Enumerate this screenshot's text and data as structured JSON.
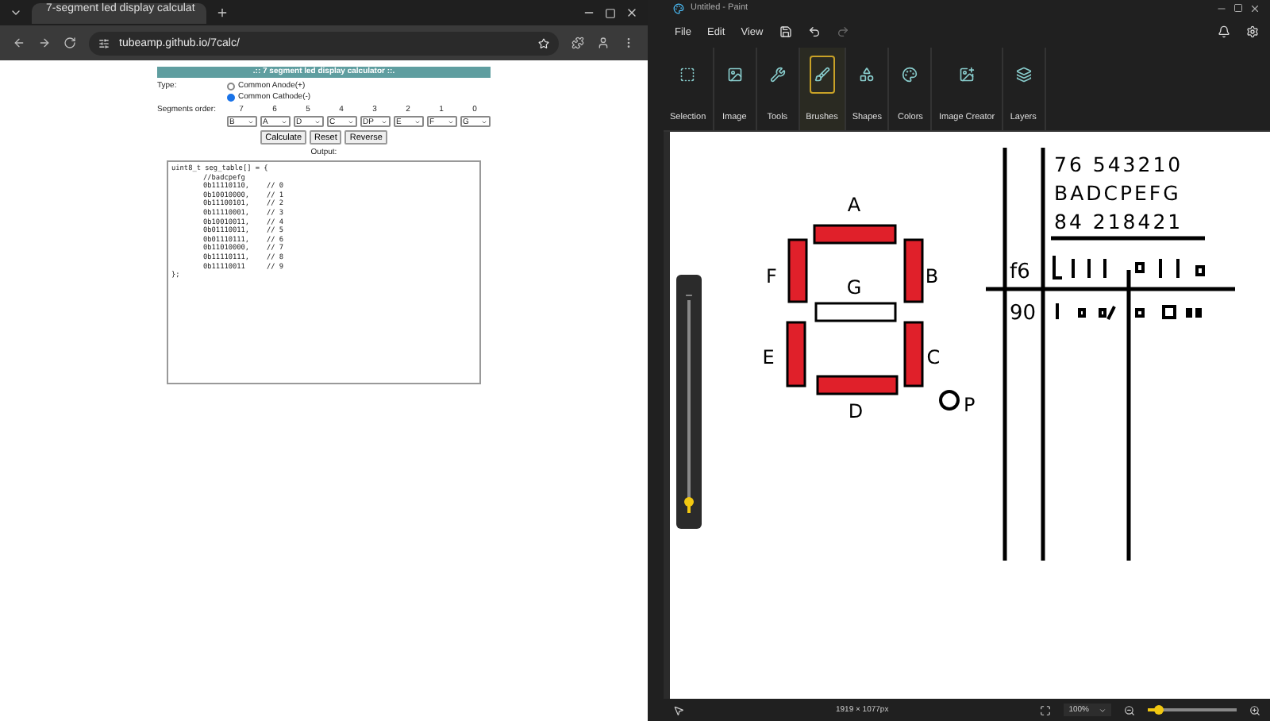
{
  "browser": {
    "tab_title": "7-segment led display calculat",
    "url": "tubeamp.github.io/7calc/"
  },
  "calculator": {
    "title": ".:: 7 segment led display calculator ::.",
    "type_label": "Type:",
    "types": [
      {
        "label": "Common Anode(+)",
        "selected": false
      },
      {
        "label": "Common Cathode(-)",
        "selected": true
      }
    ],
    "order_label": "Segments order:",
    "positions": [
      {
        "bit": "7",
        "segment": "B"
      },
      {
        "bit": "6",
        "segment": "A"
      },
      {
        "bit": "5",
        "segment": "D"
      },
      {
        "bit": "4",
        "segment": "C"
      },
      {
        "bit": "3",
        "segment": "DP"
      },
      {
        "bit": "2",
        "segment": "E"
      },
      {
        "bit": "1",
        "segment": "F"
      },
      {
        "bit": "0",
        "segment": "G"
      }
    ],
    "buttons": [
      "Calculate",
      "Reset",
      "Reverse"
    ],
    "output_label": "Output:",
    "output": {
      "header": "uint8_t seg_table[] = {",
      "comment": "//badcpefg",
      "rows": [
        {
          "value": "0b11110110,",
          "comment": "// 0"
        },
        {
          "value": "0b10010000,",
          "comment": "// 1"
        },
        {
          "value": "0b11100101,",
          "comment": "// 2"
        },
        {
          "value": "0b11110001,",
          "comment": "// 3"
        },
        {
          "value": "0b10010011,",
          "comment": "// 4"
        },
        {
          "value": "0b01110011,",
          "comment": "// 5"
        },
        {
          "value": "0b01110111,",
          "comment": "// 6"
        },
        {
          "value": "0b11010000,",
          "comment": "// 7"
        },
        {
          "value": "0b11110111,",
          "comment": "// 8"
        },
        {
          "value": "0b11110011",
          "comment": "// 9"
        }
      ],
      "footer": "};"
    }
  },
  "paint": {
    "title": "Untitled - Paint",
    "menu": [
      "File",
      "Edit",
      "View"
    ],
    "tools": [
      {
        "kind": "selection",
        "label": "Selection",
        "selected": false
      },
      {
        "kind": "image",
        "label": "Image",
        "selected": false
      },
      {
        "kind": "tools",
        "label": "Tools",
        "selected": false
      },
      {
        "kind": "brushes",
        "label": "Brushes",
        "selected": true
      },
      {
        "kind": "shapes",
        "label": "Shapes",
        "selected": false
      },
      {
        "kind": "colors",
        "label": "Colors",
        "selected": false
      },
      {
        "kind": "creator",
        "label": "Image Creator",
        "selected": false
      },
      {
        "kind": "layers",
        "label": "Layers",
        "selected": false
      }
    ],
    "canvas": {
      "segments": [
        {
          "label": "A",
          "on": true
        },
        {
          "label": "F",
          "on": true
        },
        {
          "label": "B",
          "on": true
        },
        {
          "label": "G",
          "on": false
        },
        {
          "label": "E",
          "on": true
        },
        {
          "label": "C",
          "on": true
        },
        {
          "label": "D",
          "on": true
        }
      ],
      "point_label": "P",
      "table_lines": [
        "76 543210",
        "BADCPEFG",
        "84 218421"
      ],
      "row_labels": [
        "f6",
        "90"
      ]
    },
    "brush_size": {
      "level": 0.05
    },
    "status": {
      "dimensions": "1919 × 1077px",
      "zoom": "100%",
      "zoom_slider": {
        "level": 0.12
      }
    }
  }
}
